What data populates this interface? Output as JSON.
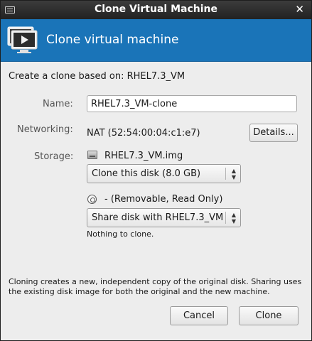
{
  "window": {
    "title": "Clone Virtual Machine",
    "close_glyph": "✕"
  },
  "header": {
    "title": "Clone virtual machine",
    "icon": "vm-play-icon"
  },
  "based_on": "Create a clone based on: RHEL7.3_VM",
  "name": {
    "label": "Name:",
    "value": "RHEL7.3_VM-clone"
  },
  "networking": {
    "label": "Networking:",
    "value": "NAT (52:54:00:04:c1:e7)",
    "details_button": "Details..."
  },
  "storage": {
    "label": "Storage:",
    "disk_name": "RHEL7.3_VM.img",
    "disk_option": "Clone this disk (8.0 GB)",
    "cdrom_name": "- (Removable, Read Only)",
    "cdrom_option": "Share disk with RHEL7.3_VM",
    "cdrom_note": "Nothing to clone."
  },
  "info_text": "Cloning creates a new, independent copy of the original disk. Sharing uses the existing disk image for both the original and the new machine.",
  "buttons": {
    "cancel": "Cancel",
    "clone": "Clone"
  },
  "colors": {
    "header_bg": "#1a74b8",
    "window_bg": "#ededed"
  }
}
